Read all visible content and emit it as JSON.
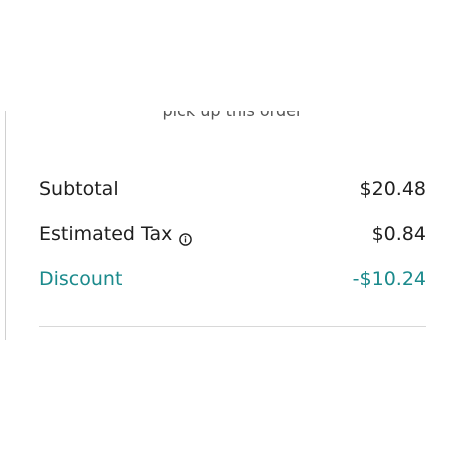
{
  "partial_text": "pick up this order",
  "summary": {
    "subtotal": {
      "label": "Subtotal",
      "value": "$20.48"
    },
    "tax": {
      "label": "Estimated Tax",
      "value": "$0.84",
      "icon": "info-icon"
    },
    "discount": {
      "label": "Discount",
      "value": "-$10.24",
      "color": "#1b8a8c"
    }
  }
}
